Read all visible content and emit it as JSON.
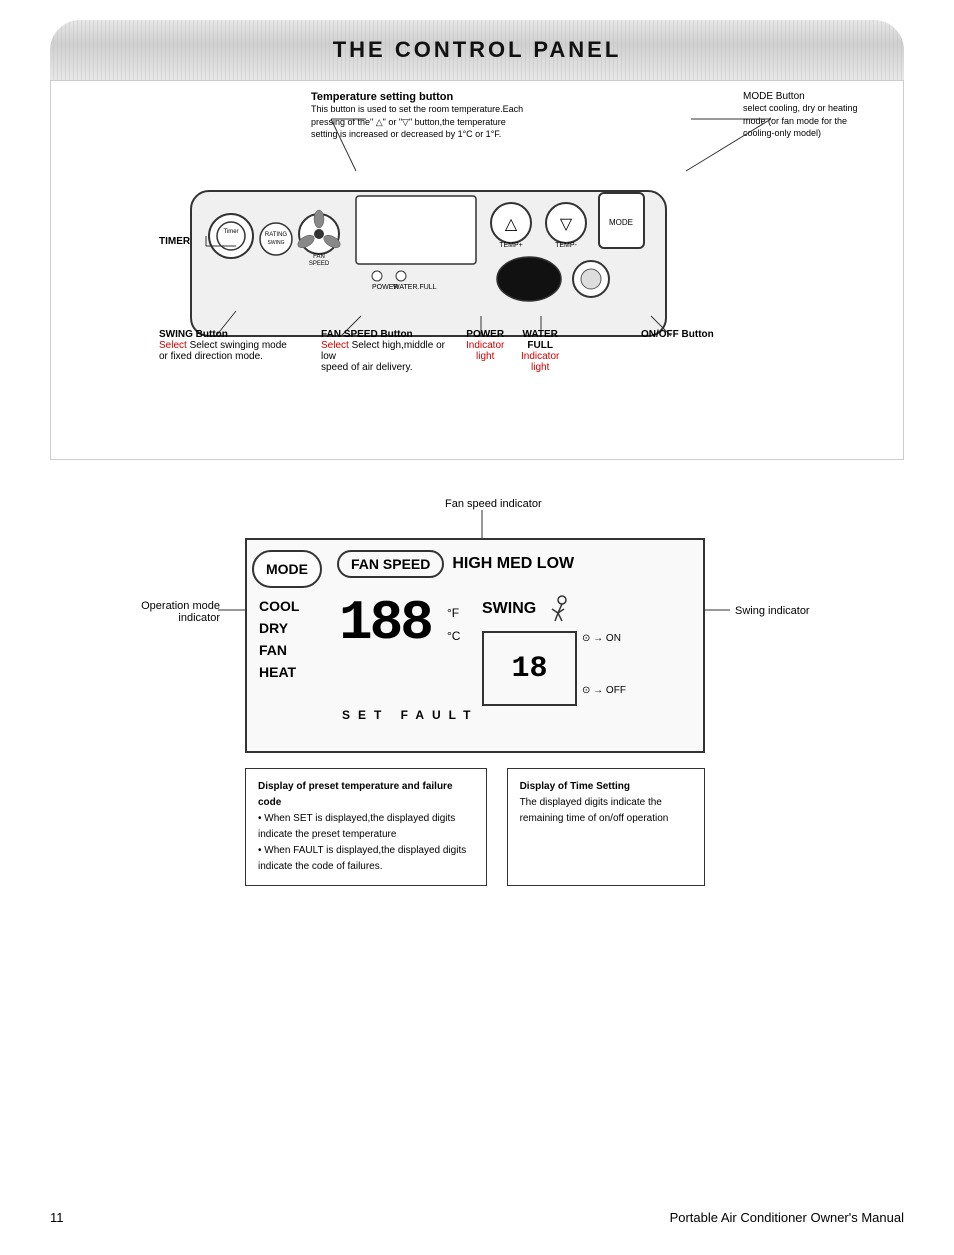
{
  "page": {
    "title": "THE CONTROL PANEL",
    "footer_page": "11",
    "footer_text": "Portable Air Conditioner Owner's Manual"
  },
  "top_section": {
    "labels": {
      "timer_button": "TIMER Button",
      "temp_setting_title": "Temperature setting button",
      "temp_setting_desc": "This button is used to set the room temperature.Each pressing of the\" △\" or \"▽\" button,the temperature setting is increased or decreased by 1°C or 1°F.",
      "mode_button_title": "MODE Button",
      "mode_button_desc": "select cooling, dry or heating mode     (or fan mode for the cooling-only model)",
      "swing_button_title": "SWING Button",
      "swing_button_desc1": "Select swinging mode",
      "swing_button_desc2": "or fixed direction mode.",
      "swing_select_red": "Select",
      "fan_speed_title": "FAN SPEED Button",
      "fan_speed_desc1": "Select high,middle or low",
      "fan_speed_desc2": "speed of air delivery.",
      "fan_select_red": "Select",
      "power_ind_title": "POWER",
      "power_ind_subtitle": "Indicator",
      "power_ind_sub2": "light",
      "water_full_title": "WATER",
      "water_full_sub": "FULL",
      "water_full_ind": "Indicator",
      "water_full_light": "light",
      "onoff_button": "ON/OFF Button"
    }
  },
  "bottom_section": {
    "fan_speed_indicator_label": "Fan speed indicator",
    "operation_mode_label_line1": "Operation mode",
    "operation_mode_label_line2": "indicator",
    "swing_indicator_label": "Swing indicator",
    "mode_btn": "MODE",
    "fan_speed_btn": "FAN SPEED",
    "high_med_low": "HIGH MED LOW",
    "cool": "COOL",
    "dry": "DRY",
    "fan": "FAN",
    "heat": "HEAT",
    "big_digits": "188",
    "degree_f": "°F",
    "degree_c": "°C",
    "swing_title": "SWING",
    "set_fault": "SET  FAULT",
    "on_arrow": "⊙ → ON",
    "off_arrow": "⊙ → OFF",
    "timer_digits": "18",
    "note1_title": "Display of preset temperature and failure code",
    "note1_point1": "• When SET is displayed,the displayed digits indicate the preset temperature",
    "note1_point2": "• When FAULT is displayed,the displayed digits indicate the code of failures.",
    "note2_title": "Display of Time Setting",
    "note2_desc": "The displayed digits indicate the remaining time of on/off operation"
  }
}
